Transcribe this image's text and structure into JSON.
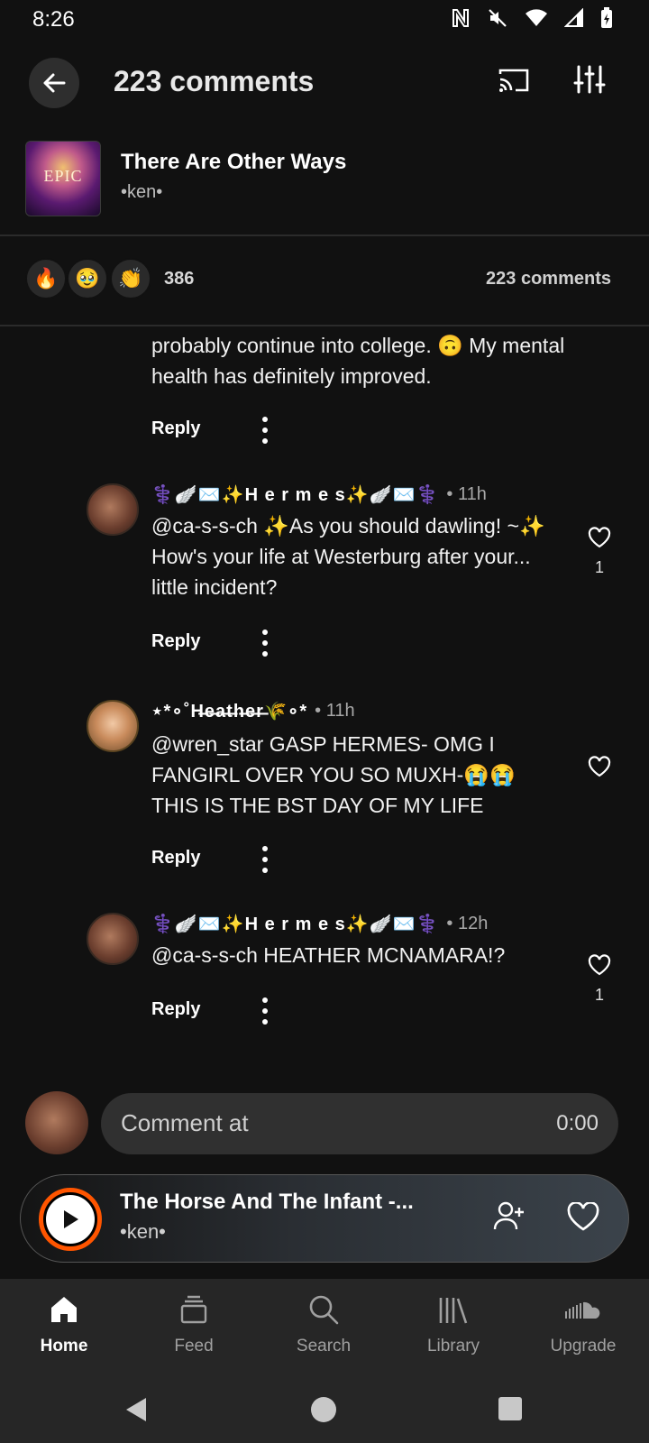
{
  "status_bar": {
    "time": "8:26"
  },
  "header": {
    "title": "223 comments"
  },
  "track": {
    "title": "There Are Other Ways",
    "artist": "•ken•",
    "art_text": "EPIC"
  },
  "reactions": {
    "emojis": [
      "🔥",
      "🥹",
      "👏"
    ],
    "count": "386",
    "comments_label": "223 comments"
  },
  "comments": [
    {
      "body": "probably continue into college. 🙃 My mental health has definitely improved.",
      "reply_label": "Reply"
    },
    {
      "user": "⚕️🪽✉️✨H e r m e s✨🪽✉️⚕️",
      "time": "• 11h",
      "body": "@ca-s-s-ch ✨As you should dawling! ~✨ How's your life at Westerburg after your... little incident?",
      "reply_label": "Reply",
      "likes": "1"
    },
    {
      "user": "⋆*∘˚H̶e̶a̶t̶h̶e̶r̶🌾∘*",
      "time": "• 11h",
      "body": "@wren_star GASP HERMES- OMG I FANGIRL OVER YOU SO MUXH-😭😭 THIS IS THE BST DAY OF MY LIFE",
      "reply_label": "Reply"
    },
    {
      "user": "⚕️🪽✉️✨H e r m e s✨🪽✉️⚕️",
      "time": "• 12h",
      "body": "@ca-s-s-ch HEATHER MCNAMARA!?",
      "reply_label": "Reply",
      "likes": "1"
    }
  ],
  "composer": {
    "placeholder": "Comment at",
    "timestamp": "0:00"
  },
  "mini_player": {
    "title": "The Horse And The Infant -...",
    "artist": "•ken•",
    "accent": "#ff5500"
  },
  "nav": {
    "items": [
      {
        "label": "Home",
        "icon": "home-icon",
        "active": true
      },
      {
        "label": "Feed",
        "icon": "feed-icon"
      },
      {
        "label": "Search",
        "icon": "search-icon"
      },
      {
        "label": "Library",
        "icon": "library-icon"
      },
      {
        "label": "Upgrade",
        "icon": "soundcloud-icon"
      }
    ]
  }
}
